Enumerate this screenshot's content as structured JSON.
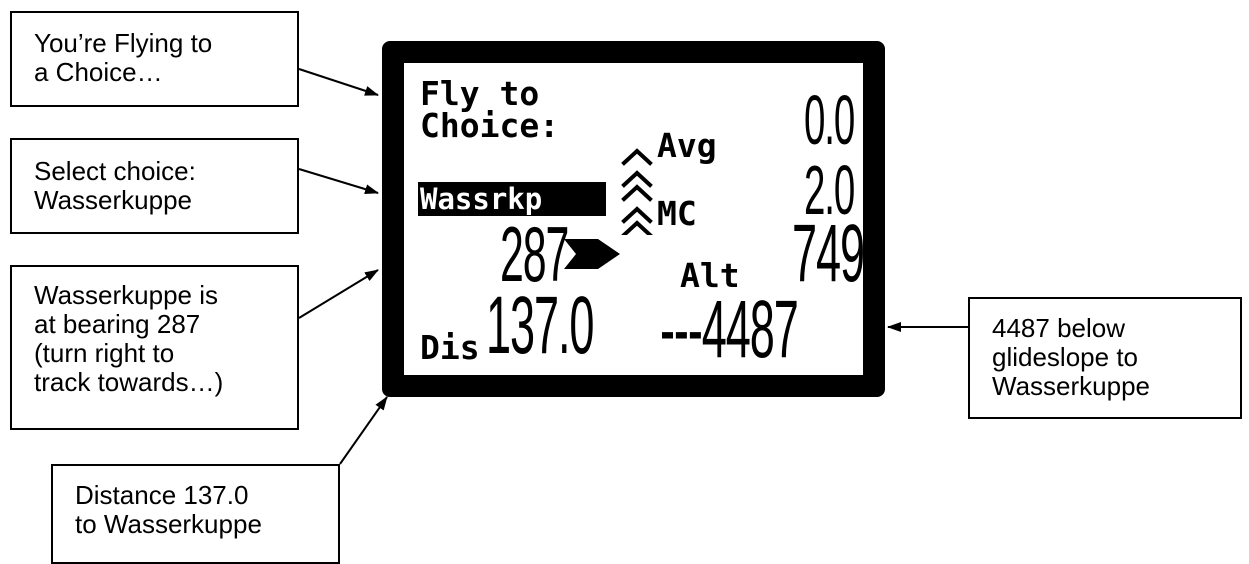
{
  "callouts": {
    "flying_to": "You’re Flying to\na Choice…",
    "select_choice": "Select choice:\nWasserkuppe",
    "bearing": "Wasserkuppe is\nat bearing 287\n(turn right to\ntrack towards…)",
    "distance": "Distance 137.0\nto Wasserkuppe",
    "glideslope": "4487 below\nglideslope to\nWasserkuppe"
  },
  "display": {
    "line1": "Fly to",
    "line2": "Choice:",
    "waypoint": "Wassrkp",
    "bearing": "287",
    "dis_label": "Dis",
    "distance": "137.0",
    "avg_label": "Avg",
    "avg_value": "0.0",
    "mc_label": "MC",
    "mc_value": "2.0",
    "alt_label": "Alt",
    "alt_value": "749",
    "glide_value": "---4487"
  },
  "colors": {
    "lcd_frame": "#000000",
    "lcd_screen": "#ffffff",
    "ink": "#000000"
  },
  "icons": [
    "climb-chevrons-icon",
    "right-arrow-icon"
  ]
}
